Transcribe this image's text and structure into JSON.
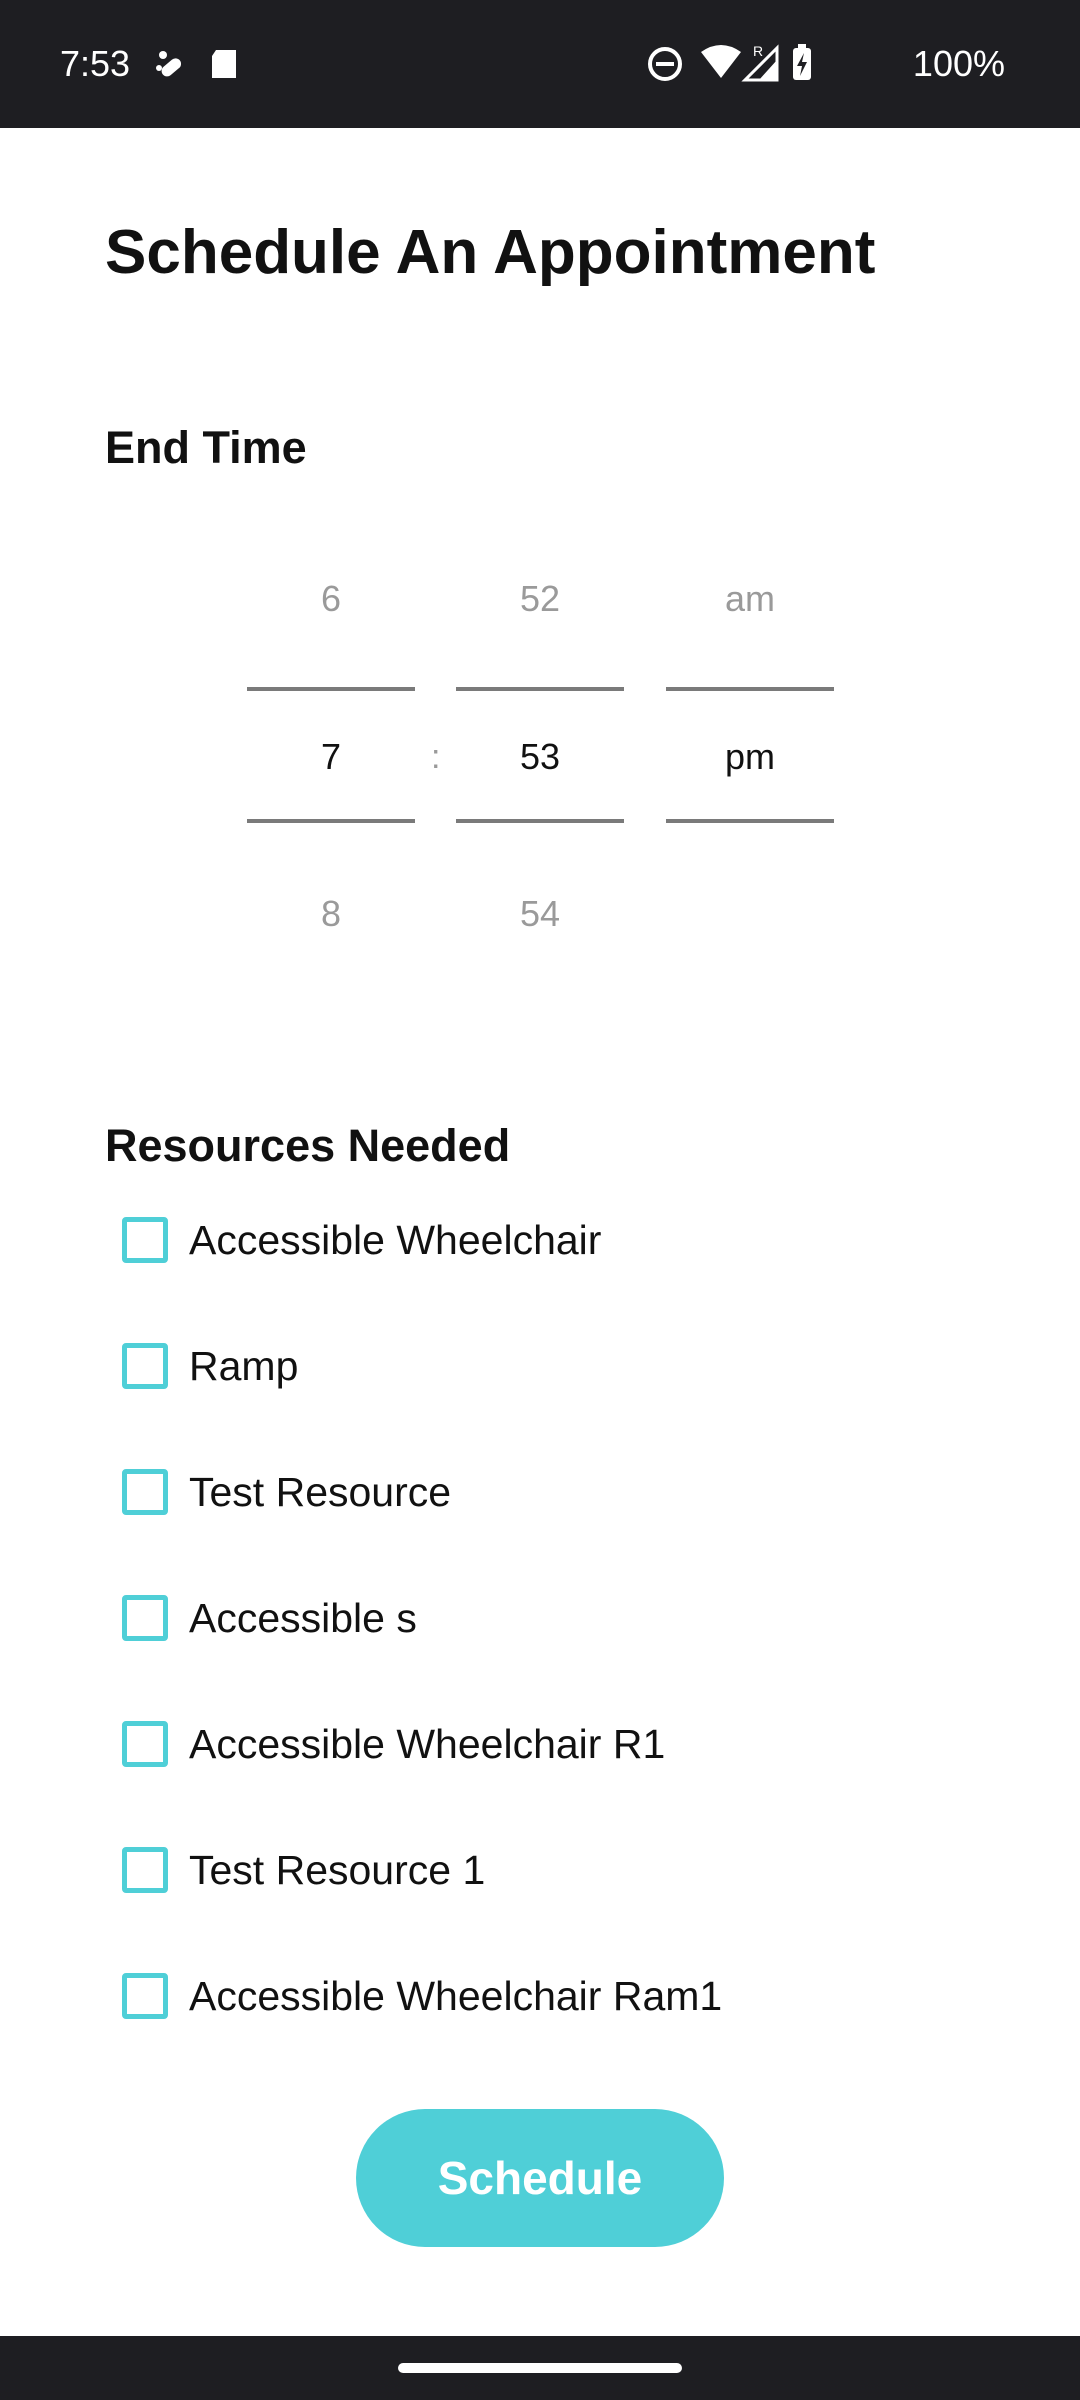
{
  "status_bar": {
    "time": "7:53",
    "battery": "100%",
    "icons_left": [
      "pill-icon",
      "sd-card-icon"
    ],
    "icons_right": [
      "do-not-disturb-icon",
      "wifi-icon",
      "signal-roaming-icon",
      "battery-charging-icon"
    ]
  },
  "page": {
    "title": "Schedule An Appointment"
  },
  "end_time": {
    "label": "End Time",
    "hour": {
      "prev": "6",
      "current": "7",
      "next": "8"
    },
    "separator": ":",
    "minute": {
      "prev": "52",
      "current": "53",
      "next": "54"
    },
    "period": {
      "prev": "am",
      "current": "pm"
    }
  },
  "resources": {
    "label": "Resources Needed",
    "items": [
      {
        "label": "Accessible Wheelchair",
        "checked": false
      },
      {
        "label": "Ramp",
        "checked": false
      },
      {
        "label": "Test Resource",
        "checked": false
      },
      {
        "label": "Accessible s",
        "checked": false
      },
      {
        "label": "Accessible Wheelchair R1",
        "checked": false
      },
      {
        "label": "Test Resource 1",
        "checked": false
      },
      {
        "label": "Accessible Wheelchair Ram1",
        "checked": false
      }
    ]
  },
  "actions": {
    "schedule_label": "Schedule"
  },
  "colors": {
    "accent": "#4fcfd7",
    "status_bar_bg": "#1e1e22",
    "text": "#111111",
    "muted_text": "#9a9a9a"
  }
}
